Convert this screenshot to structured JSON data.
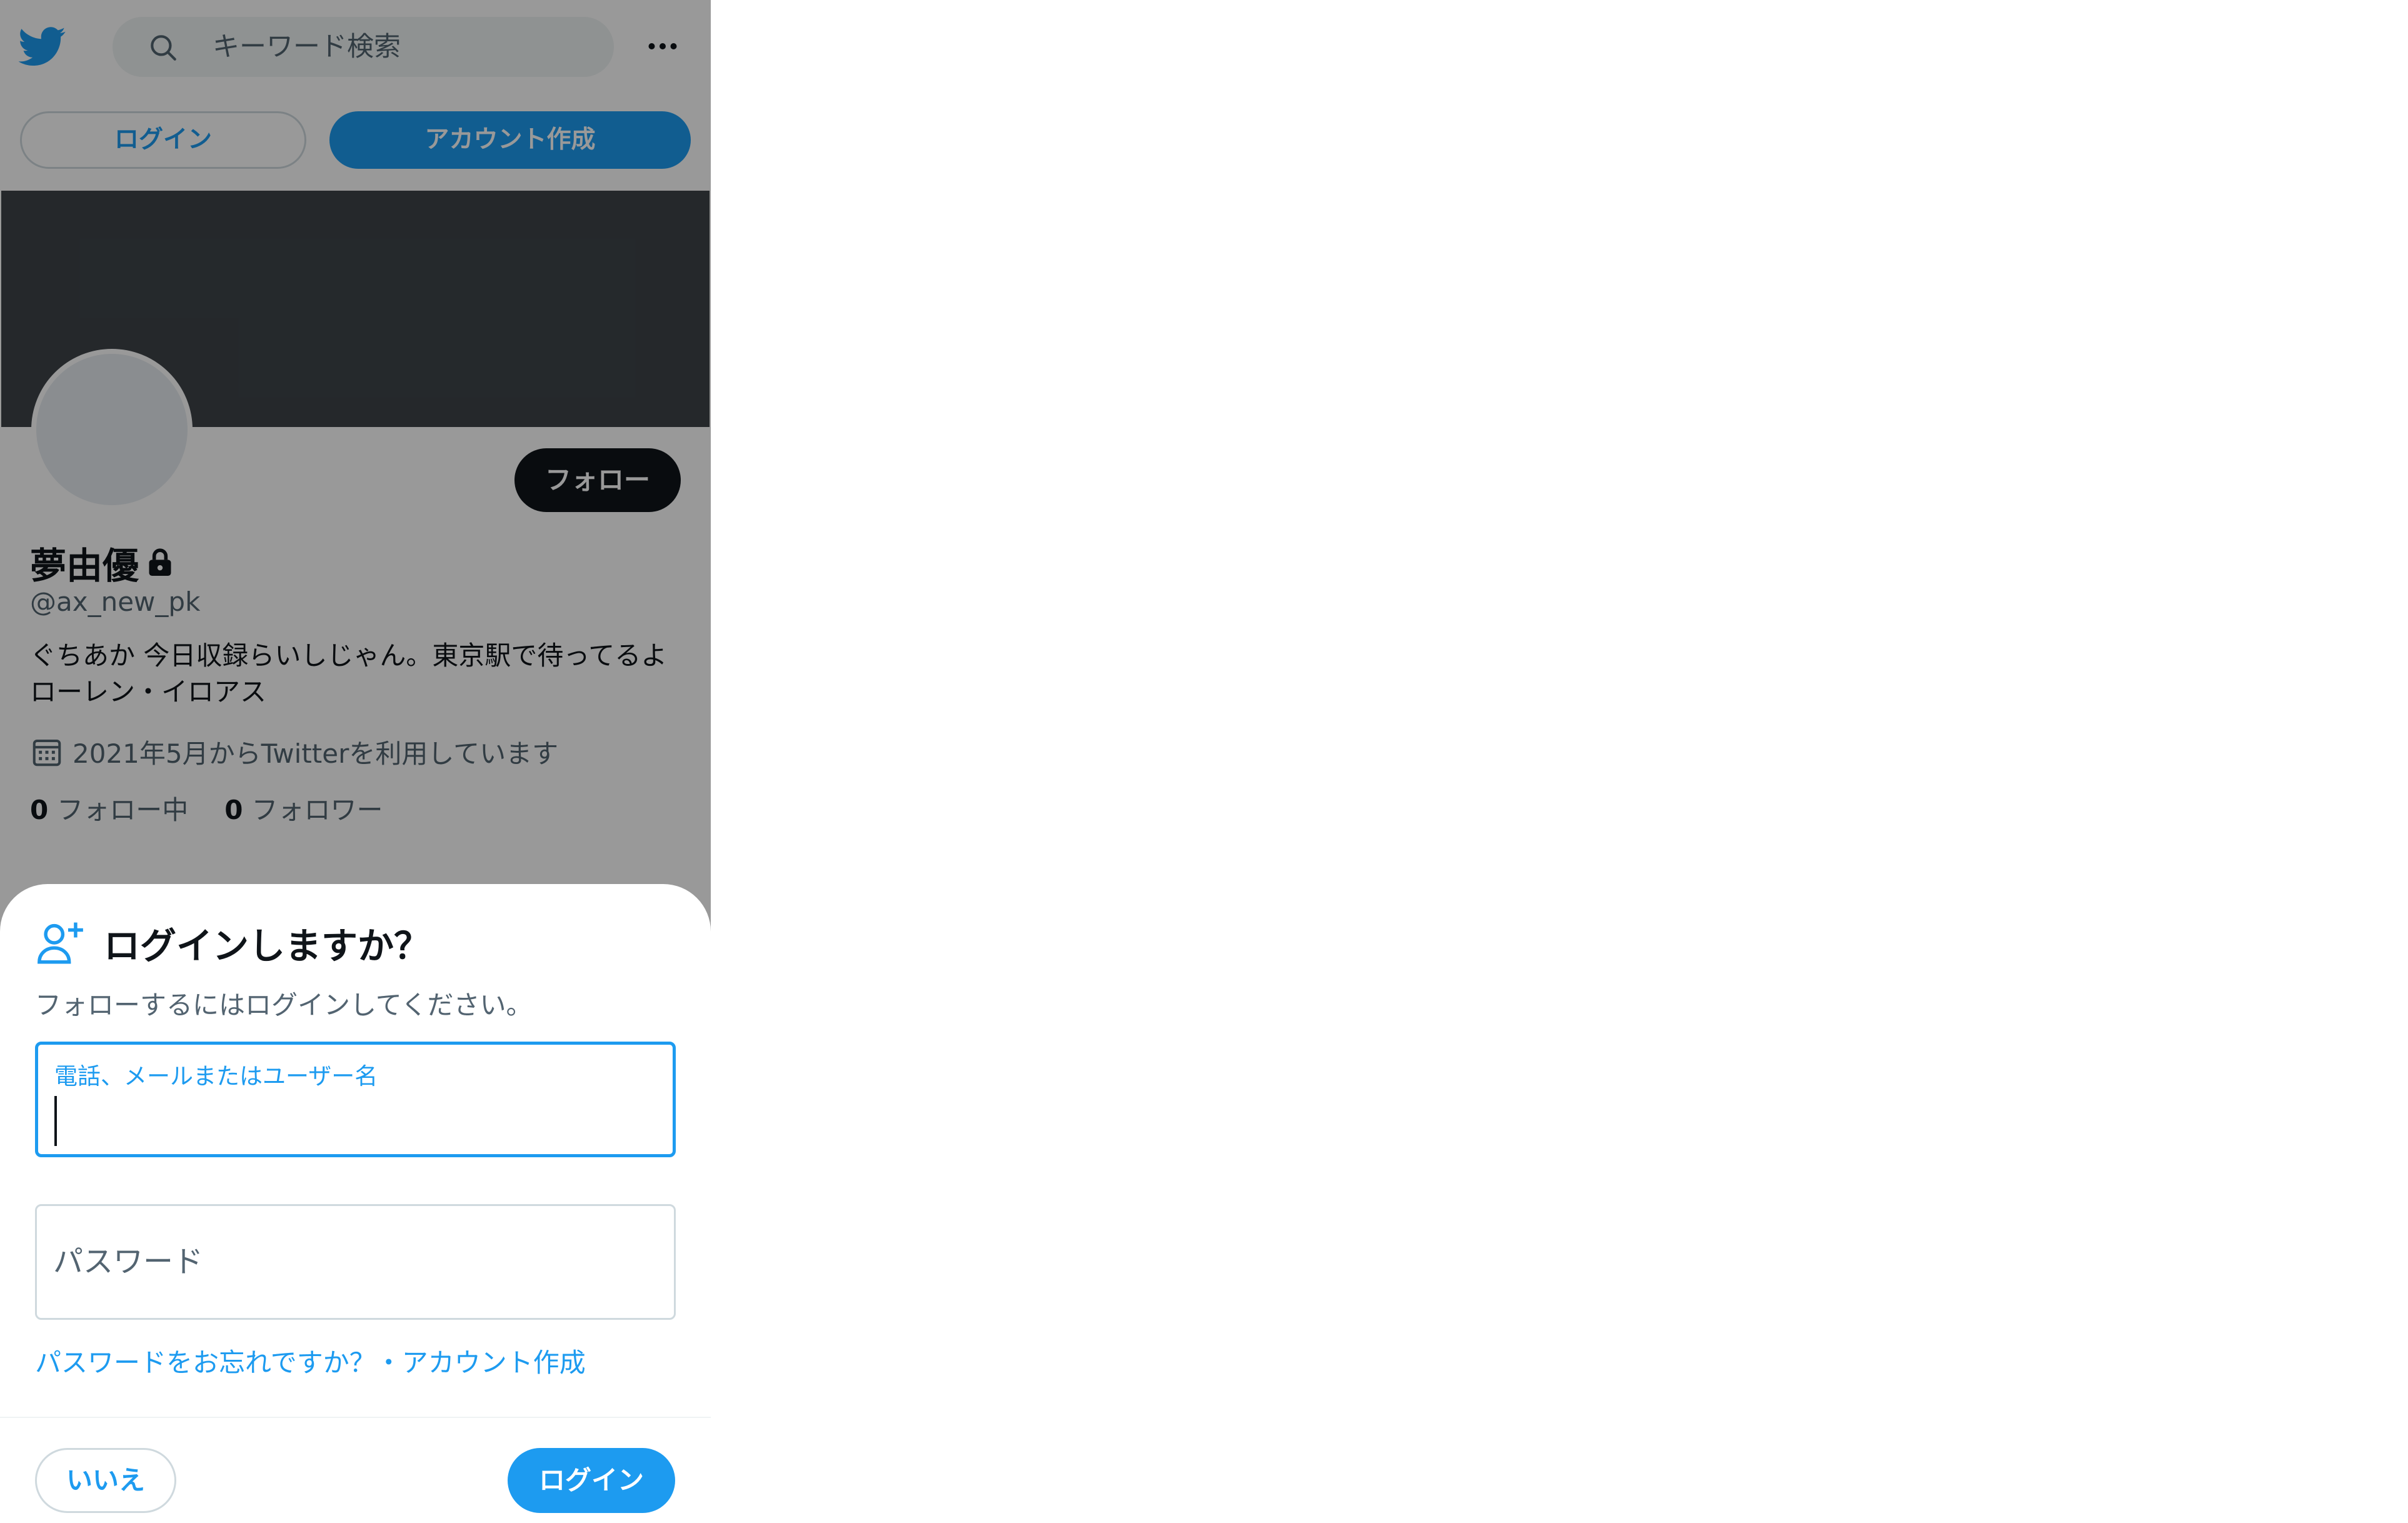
{
  "header": {
    "logo_icon": "twitter-bird-icon",
    "search_icon": "search-icon",
    "search_placeholder": "キーワード検索",
    "more_icon": "more-horizontal-icon"
  },
  "auth": {
    "login_label": "ログイン",
    "signup_label": "アカウント作成"
  },
  "profile": {
    "follow_label": "フォロー",
    "name": "夢由優",
    "lock_icon": "lock-icon",
    "handle": "@ax_new_pk",
    "bio_line1": "ぐちあか 今日収録らいしじゃん。東京駅で待ってるよ",
    "bio_line2": "ローレン・イロアス",
    "calendar_icon": "calendar-icon",
    "joined": "2021年5月からTwitterを利用しています",
    "following_count": "0",
    "following_label": "フォロー中",
    "followers_count": "0",
    "followers_label": "フォロワー"
  },
  "login_sheet": {
    "icon": "add-user-icon",
    "title": "ログインしますか？",
    "subtitle": "フォローするにはログインしてください。",
    "username_label": "電話、メールまたはユーザー名",
    "password_label": "パスワード",
    "forgot_link": "パスワードをお忘れですか？",
    "separator": "・",
    "signup_link": "アカウント作成",
    "no_label": "いいえ",
    "login_label": "ログイン"
  },
  "colors": {
    "accent": "#1d9bf0",
    "text": "#0f1419",
    "secondary": "#536471",
    "banner": "#3e4449"
  }
}
